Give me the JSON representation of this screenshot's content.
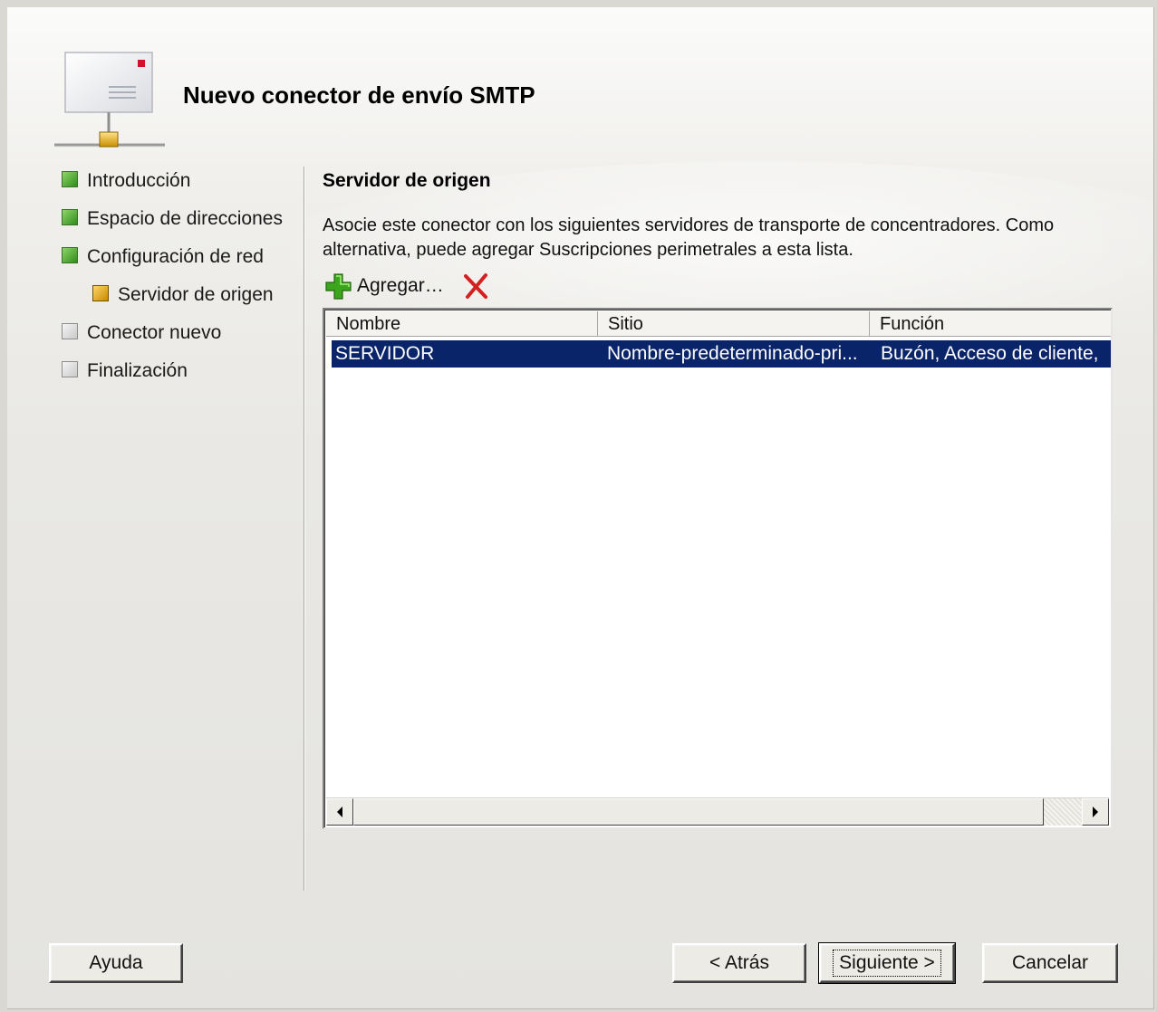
{
  "dialog": {
    "title": "Nuevo conector de envío SMTP"
  },
  "steps": [
    {
      "label": "Introducción",
      "state": "done"
    },
    {
      "label": "Espacio de direcciones",
      "state": "done"
    },
    {
      "label": "Configuración de red",
      "state": "done"
    },
    {
      "label": "Servidor de origen",
      "state": "current"
    },
    {
      "label": "Conector nuevo",
      "state": "pending"
    },
    {
      "label": "Finalización",
      "state": "pending"
    }
  ],
  "main": {
    "section_title": "Servidor de origen",
    "description": "Asocie este conector con los siguientes servidores de transporte de concentradores. Como alternativa, puede agregar Suscripciones perimetrales a esta lista.",
    "toolbar": {
      "add_label": "Agregar…",
      "add_icon": "green-plus-icon",
      "remove_icon": "red-x-icon"
    },
    "list": {
      "columns": [
        "Nombre",
        "Sitio",
        "Función"
      ],
      "rows": [
        {
          "nombre": "SERVIDOR",
          "sitio": "Nombre-predeterminado-pri...",
          "funcion": "Buzón, Acceso de cliente,",
          "selected": true
        }
      ]
    }
  },
  "buttons": {
    "help": "Ayuda",
    "back": "< Atrás",
    "next": "Siguiente >",
    "cancel": "Cancelar"
  },
  "colors": {
    "selection": "#0a246a",
    "step_done": "#2f8d1b",
    "step_current": "#c88a00",
    "remove_icon": "#d32020",
    "add_icon": "#3aa51d"
  }
}
